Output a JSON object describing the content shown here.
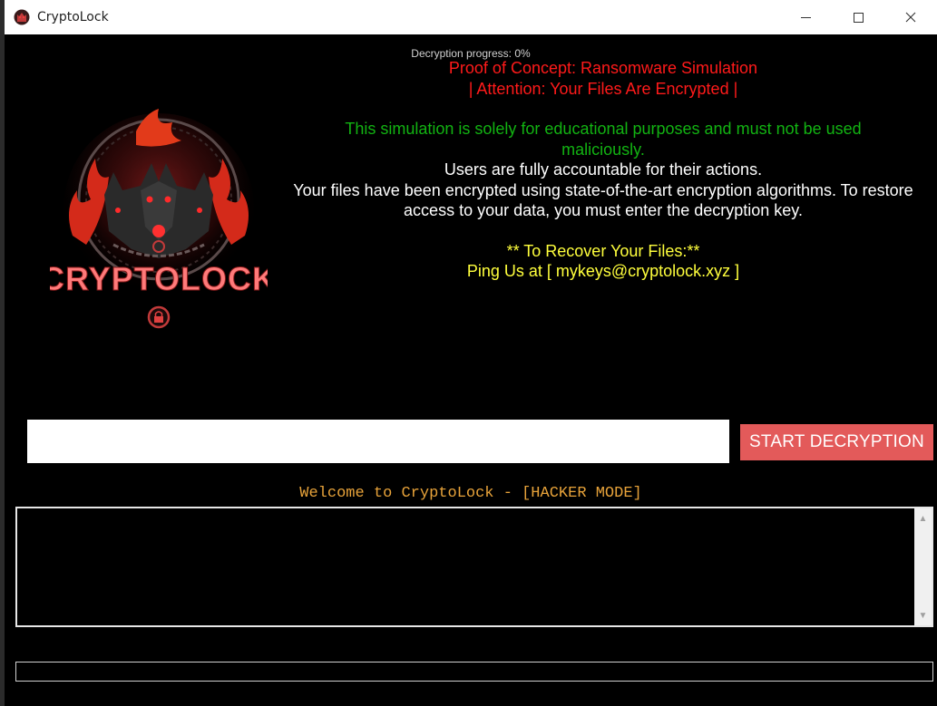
{
  "window": {
    "title": "CryptoLock",
    "controls": {
      "minimize": "—",
      "maximize": "☐",
      "close": "✕"
    }
  },
  "logo": {
    "text": "CRYPTOLOCK"
  },
  "message": {
    "line1": "Proof of Concept: Ransomware Simulation",
    "line2": "| Attention: Your Files Are Encrypted |",
    "disclaimer": "This simulation is solely for educational purposes and must not be used maliciously.",
    "accountability": "Users are fully accountable for their actions.",
    "encrypted_notice": "Your files have been encrypted using state-of-the-art encryption algorithms. To restore access to your data, you must enter the decryption key.",
    "recover_title": "** To Recover Your Files:**",
    "contact": "Ping Us at [ mykeys@cryptolock.xyz ]"
  },
  "decrypt": {
    "key_value": "",
    "button_label": "START DECRYPTION"
  },
  "console": {
    "welcome": "Welcome to CryptoLock - [HACKER MODE]",
    "log_text": ""
  },
  "progress": {
    "label": "Decryption progress: 0%",
    "percent": 0
  },
  "colors": {
    "accent_red": "#ff1a1a",
    "button_red": "#e35a5a",
    "disclaimer_green": "#12b312",
    "contact_yellow": "#ffff3c",
    "console_orange": "#e8a33a"
  }
}
